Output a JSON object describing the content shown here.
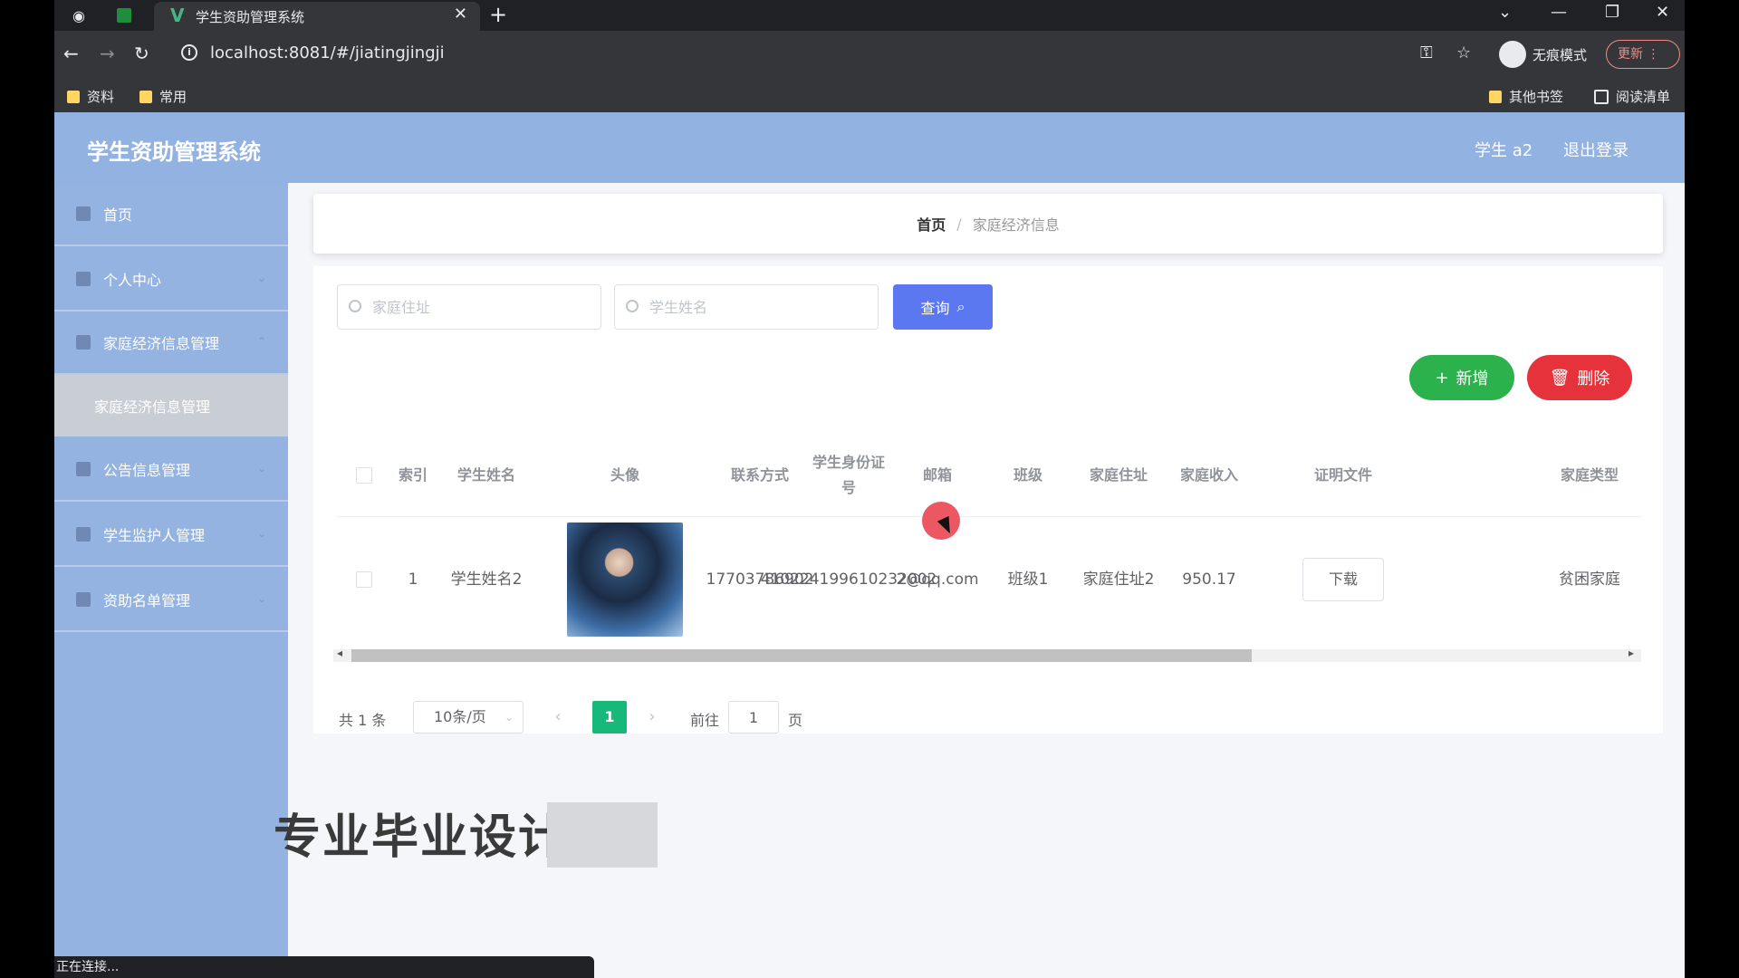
{
  "browser": {
    "tab_title": "学生资助管理系统",
    "url": "localhost:8081/#/jiatingjingji",
    "incognito_label": "无痕模式",
    "update_label": "更新",
    "bookmarks": [
      "资料",
      "常用"
    ],
    "other_bookmarks": "其他书签",
    "reading_list": "阅读清单",
    "status_text": "正在连接..."
  },
  "app": {
    "title": "学生资助管理系统",
    "user": "学生 a2",
    "logout": "退出登录",
    "accent": "#92b2e2"
  },
  "sidebar": {
    "items": [
      {
        "label": "首页",
        "icon": "home-icon"
      },
      {
        "label": "个人中心",
        "icon": "user-icon"
      },
      {
        "label": "家庭经济信息管理",
        "icon": "monitor-icon"
      },
      {
        "label": "公告信息管理",
        "icon": "document-icon"
      },
      {
        "label": "学生监护人管理",
        "icon": "send-icon"
      },
      {
        "label": "资助名单管理",
        "icon": "flag-icon"
      }
    ],
    "submenu_label": "家庭经济信息管理"
  },
  "breadcrumb": {
    "home": "首页",
    "separator": "/",
    "current": "家庭经济信息"
  },
  "search": {
    "address_placeholder": "家庭住址",
    "name_placeholder": "学生姓名",
    "query_label": "查询"
  },
  "actions": {
    "add_label": "新增",
    "delete_label": "删除"
  },
  "table": {
    "headers": {
      "index": "索引",
      "name": "学生姓名",
      "avatar": "头像",
      "phone": "联系方式",
      "id_card": "学生身份证号",
      "email": "邮箱",
      "class": "班级",
      "address": "家庭住址",
      "income": "家庭收入",
      "proof": "证明文件",
      "family_type": "家庭类型"
    },
    "row": {
      "index": "1",
      "name": "学生姓名2",
      "phone": "17703786902",
      "id_card": "410224199610232002",
      "email": "2@qq.com",
      "class": "班级1",
      "address": "家庭住址2",
      "income": "950.17",
      "proof_button": "下载",
      "family_type": "贫困家庭"
    }
  },
  "pagination": {
    "total": "共 1 条",
    "page_size": "10条/页",
    "current_page": "1",
    "goto_label": "前往",
    "goto_value": "1",
    "page_unit": "页"
  },
  "overlay": {
    "watermark": "专业毕业设计"
  }
}
